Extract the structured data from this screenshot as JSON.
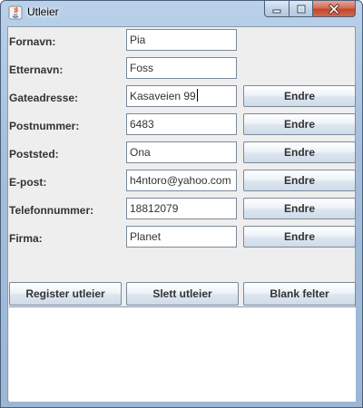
{
  "window": {
    "title": "Utleier",
    "icon": "java-app-icon",
    "controls": [
      "minimize-icon",
      "maximize-icon",
      "close-icon"
    ]
  },
  "form": {
    "rows": [
      {
        "label": "Fornavn:",
        "value": "Pia",
        "has_button": false
      },
      {
        "label": "Etternavn:",
        "value": "Foss",
        "has_button": false
      },
      {
        "label": "Gateadresse:",
        "value": "Kasaveien 99",
        "has_button": true
      },
      {
        "label": "Postnummer:",
        "value": "6483",
        "has_button": true
      },
      {
        "label": "Poststed:",
        "value": "Ona",
        "has_button": true
      },
      {
        "label": "E-post:",
        "value": "h4ntoro@yahoo.com",
        "has_button": true
      },
      {
        "label": "Telefonnummer:",
        "value": "18812079",
        "has_button": true
      },
      {
        "label": "Firma:",
        "value": "Planet",
        "has_button": true
      }
    ],
    "edit_button_label": "Endre"
  },
  "actions": {
    "register": "Register utleier",
    "delete": "Slett utleier",
    "clear": "Blank felter"
  },
  "colors": {
    "frame": "#b9d1ea",
    "panel": "#eeeeee",
    "close_button": "#c2472c"
  }
}
